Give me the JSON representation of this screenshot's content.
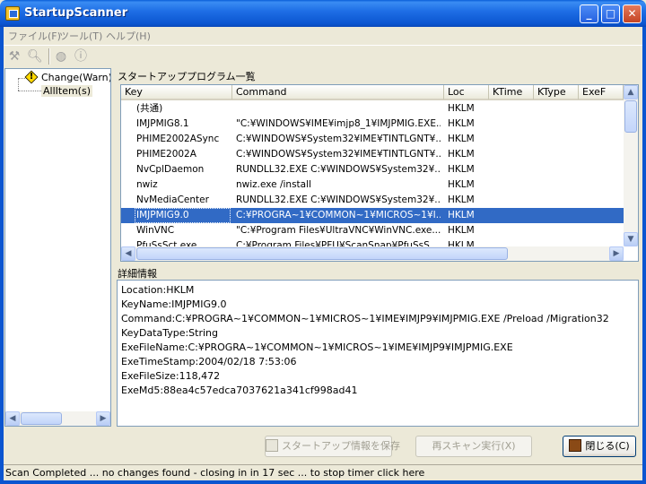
{
  "window": {
    "title": "StartupScanner"
  },
  "menu": {
    "items": [
      "ファイル(F)",
      "ツール(T)",
      "ヘルプ(H)"
    ]
  },
  "toolbar": {
    "icons": [
      "wrench-icon",
      "search-icon",
      "globe-icon",
      "info-icon"
    ]
  },
  "tree": {
    "items": [
      {
        "label": "Change(Warn)It",
        "icon": "warning-icon"
      },
      {
        "label": "AllItem(s)",
        "selected": true
      }
    ]
  },
  "list": {
    "title": "スタートアッププログラム一覧",
    "columns": [
      "Key",
      "Command",
      "Loc",
      "KTime",
      "KType",
      "ExeF"
    ],
    "rows": [
      {
        "key": "(共通)",
        "command": "",
        "loc": "HKLM"
      },
      {
        "key": "IMJPMIG8.1",
        "command": "\"C:¥WINDOWS¥IME¥imjp8_1¥IMJPMIG.EXE...",
        "loc": "HKLM"
      },
      {
        "key": "PHIME2002ASync",
        "command": "C:¥WINDOWS¥System32¥IME¥TINTLGNT¥...",
        "loc": "HKLM"
      },
      {
        "key": "PHIME2002A",
        "command": "C:¥WINDOWS¥System32¥IME¥TINTLGNT¥...",
        "loc": "HKLM"
      },
      {
        "key": "NvCplDaemon",
        "command": "RUNDLL32.EXE C:¥WINDOWS¥System32¥...",
        "loc": "HKLM"
      },
      {
        "key": "nwiz",
        "command": "nwiz.exe /install",
        "loc": "HKLM"
      },
      {
        "key": "NvMediaCenter",
        "command": "RUNDLL32.EXE C:¥WINDOWS¥System32¥...",
        "loc": "HKLM"
      },
      {
        "key": "IMJPMIG9.0",
        "command": "C:¥PROGRA~1¥COMMON~1¥MICROS~1¥I...",
        "loc": "HKLM",
        "selected": true
      },
      {
        "key": "WinVNC",
        "command": "\"C:¥Program Files¥UltraVNC¥WinVNC.exe...",
        "loc": "HKLM"
      },
      {
        "key": "PfuSsSct.exe",
        "command": "C:¥Program Files¥PFU¥ScanSnap¥PfuSsS...",
        "loc": "HKLM"
      }
    ]
  },
  "details": {
    "title": "詳細情報",
    "lines": [
      "Location:HKLM",
      "KeyName:IMJPMIG9.0",
      "Command:C:¥PROGRA~1¥COMMON~1¥MICROS~1¥IME¥IMJP9¥IMJPMIG.EXE /Preload /Migration32",
      "KeyDataType:String",
      "ExeFileName:C:¥PROGRA~1¥COMMON~1¥MICROS~1¥IME¥IMJP9¥IMJPMIG.EXE",
      "ExeTimeStamp:2004/02/18 7:53:06",
      "ExeFileSize:118,472",
      "ExeMd5:88ea4c57edca7037621a341cf998ad41"
    ]
  },
  "buttons": {
    "save": "スタートアップ情報を保存",
    "rescan": "再スキャン実行(X)",
    "close": "閉じる(C)"
  },
  "status": {
    "text": "Scan Completed ... no changes found - closing in in 17 sec ... to stop timer click here"
  }
}
